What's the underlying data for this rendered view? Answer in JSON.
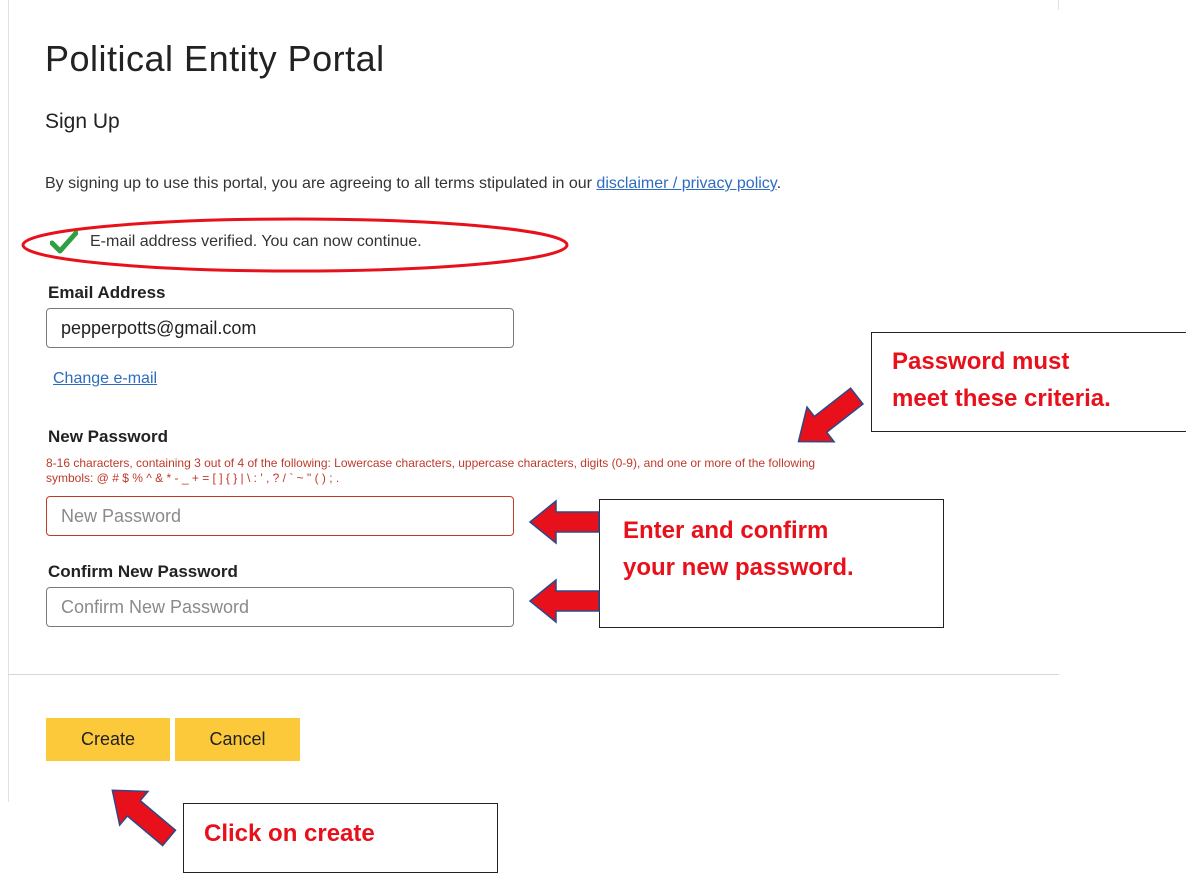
{
  "page": {
    "title": "Political Entity Portal",
    "section_title": "Sign Up",
    "terms_text": "By signing up to use this portal, you are agreeing to all terms stipulated in our ",
    "terms_link": "disclaimer / privacy policy",
    "terms_end": "."
  },
  "verification": {
    "message": "E-mail address verified. You can now continue.",
    "icon": "checkmark-icon",
    "color": "#2ea043",
    "highlight_color": "#e8101a"
  },
  "form": {
    "email_label": "Email Address",
    "email_value": "pepperpotts@gmail.com",
    "change_email_link": "Change e-mail",
    "new_password_label": "New Password",
    "password_criteria": "8-16 characters, containing 3 out of 4 of the following: Lowercase characters, uppercase characters, digits (0-9), and one or more of the following symbols: @ # $ % ^ & * - _ + = [ ] { } | \\ : ' , ? / ` ~ \" ( ) ; .",
    "new_password_placeholder": "New Password",
    "confirm_password_label": "Confirm New Password",
    "confirm_password_placeholder": "Confirm New Password"
  },
  "buttons": {
    "create": "Create",
    "cancel": "Cancel",
    "color": "#fcc93b"
  },
  "annotations": {
    "color": "#e8101a",
    "password_criteria_note": [
      "Password must",
      "meet these criteria."
    ],
    "enter_confirm_note": [
      "Enter and confirm",
      "your new password."
    ],
    "click_create_note": "Click on create"
  }
}
